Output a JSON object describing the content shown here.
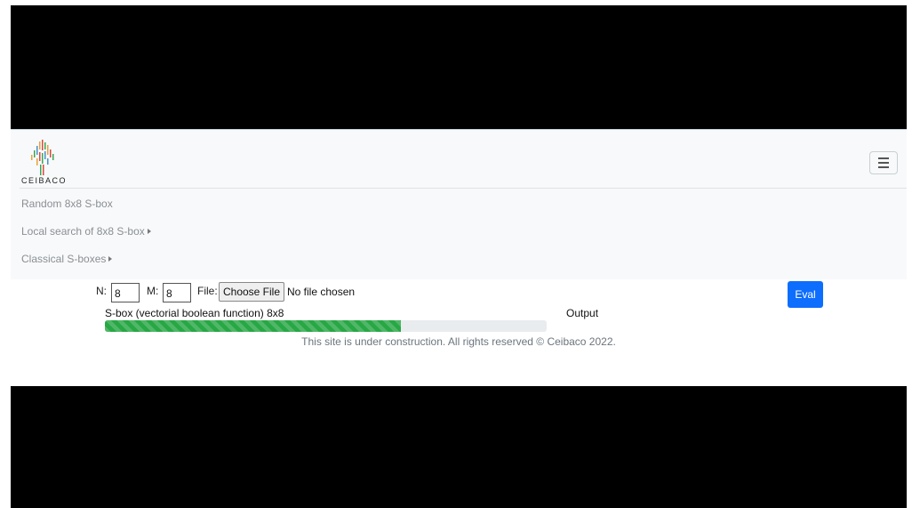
{
  "brand": {
    "name": "CEIBACO",
    "logo_icon": "tree-barcode-logo"
  },
  "nav": {
    "toggler_icon": "hamburger-menu-icon",
    "items": [
      {
        "label": "Random 8x8 S-box",
        "has_submenu": false
      },
      {
        "label": "Local search of 8x8 S-box",
        "has_submenu": true
      },
      {
        "label": "Classical S-boxes",
        "has_submenu": true
      }
    ]
  },
  "form": {
    "n_label": "N:",
    "n_value": "8",
    "m_label": "M:",
    "m_value": "8",
    "file_label": "File:",
    "file_button": "Choose File",
    "file_status": "No file chosen",
    "eval_button": "Eval",
    "sbox_label": "S-box (vectorial boolean function) 8x8",
    "output_label": "Output",
    "progress_fraction": 0.67
  },
  "footer": {
    "text": "This site is under construction. All rights reserved © Ceibaco 2022."
  },
  "colors": {
    "accent": "#0d6efd",
    "progress": "#28a745",
    "navbar_bg": "#f8f9fa"
  }
}
